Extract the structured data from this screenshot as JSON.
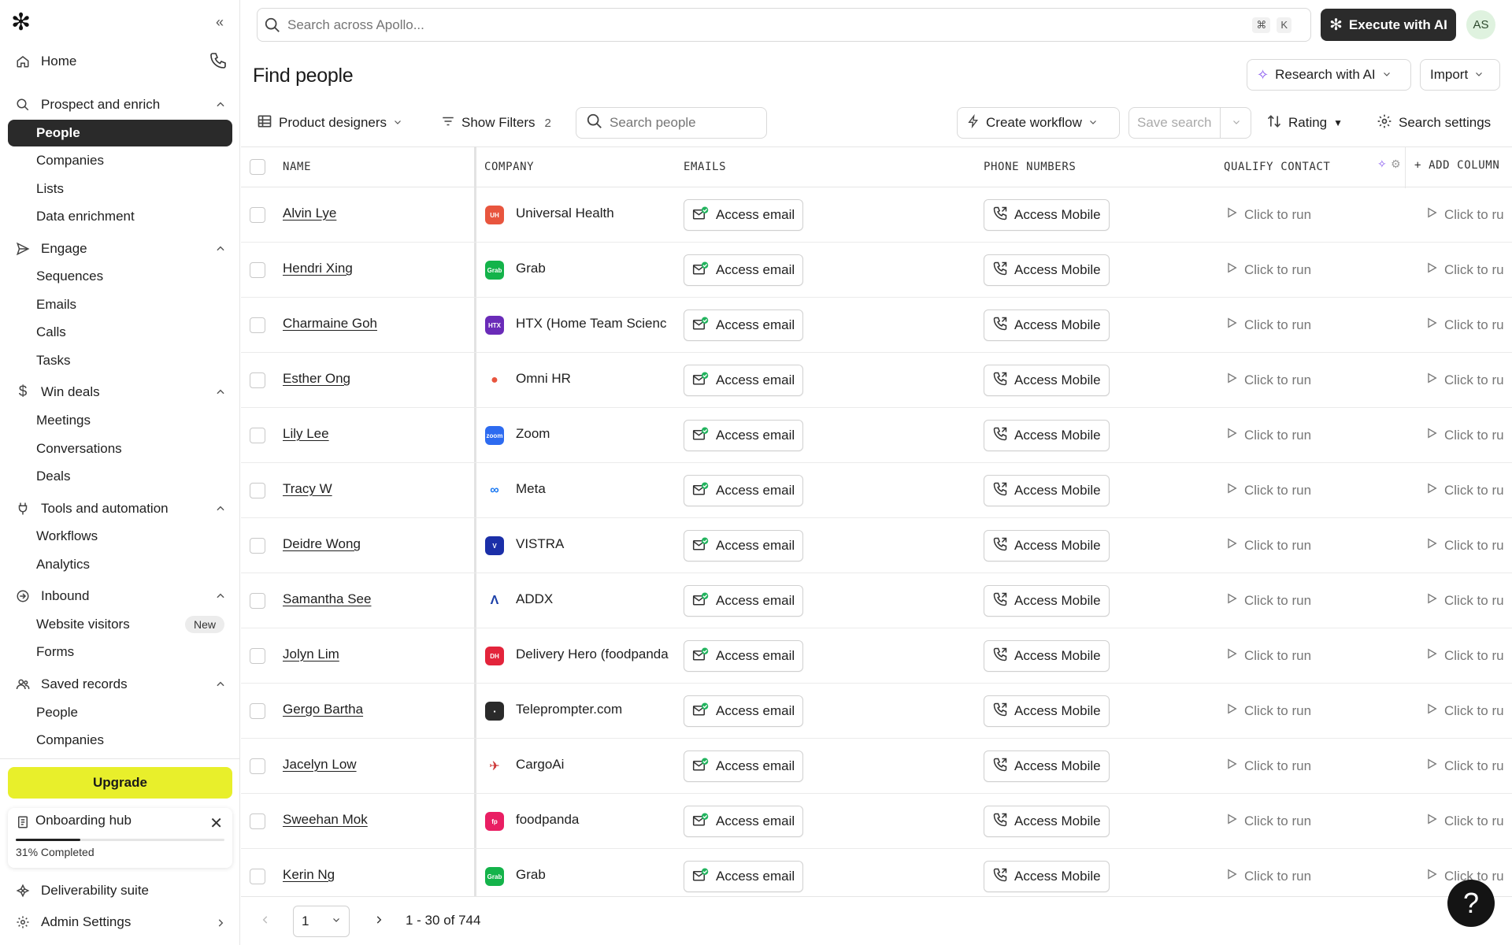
{
  "search": {
    "placeholder": "Search across Apollo...",
    "kbd1": "⌘",
    "kbd2": "K"
  },
  "top": {
    "execute_label": "Execute with AI",
    "avatar_initials": "AS"
  },
  "sidebar": {
    "home": "Home",
    "prospect": "Prospect and enrich",
    "people": "People",
    "companies": "Companies",
    "lists": "Lists",
    "data_enrichment": "Data enrichment",
    "engage": "Engage",
    "sequences": "Sequences",
    "emails": "Emails",
    "calls": "Calls",
    "tasks": "Tasks",
    "win_deals": "Win deals",
    "meetings": "Meetings",
    "conversations": "Conversations",
    "deals": "Deals",
    "tools": "Tools and automation",
    "workflows": "Workflows",
    "analytics": "Analytics",
    "inbound": "Inbound",
    "website_visitors": "Website visitors",
    "new_badge": "New",
    "forms": "Forms",
    "saved_records": "Saved records",
    "saved_people": "People",
    "saved_companies": "Companies",
    "upgrade": "Upgrade",
    "onboarding_title": "Onboarding hub",
    "onboarding_pct_text": "31% Completed",
    "onboarding_progress": 0.31,
    "deliverability": "Deliverability suite",
    "admin": "Admin Settings"
  },
  "header": {
    "title": "Find people",
    "research_ai": "Research with AI",
    "import": "Import",
    "list_view": "Product designers",
    "show_filters": "Show Filters",
    "filter_count": "2",
    "search_people_placeholder": "Search people",
    "create_workflow": "Create workflow",
    "save_search": "Save search",
    "rating": "Rating",
    "search_settings": "Search settings"
  },
  "table": {
    "columns": {
      "name": "NAME",
      "company": "COMPANY",
      "emails": "EMAILS",
      "phone": "PHONE NUMBERS",
      "qualify": "QUALIFY CONTACT",
      "add_column": "ADD COLUMN"
    },
    "access_email": "Access email",
    "access_mobile": "Access Mobile",
    "click_to_run": "Click to run",
    "click_to_run_clipped": "Click to ru",
    "rows": [
      {
        "name": "Alvin Lye",
        "company": "Universal Health",
        "logo_text": "UH",
        "logo_color": "#e8553e"
      },
      {
        "name": "Hendri Xing",
        "company": "Grab",
        "logo_text": "Grab",
        "logo_color": "#14b34a"
      },
      {
        "name": "Charmaine Goh",
        "company": "HTX (Home Team Scienc",
        "logo_text": "HTX",
        "logo_color": "#6a2bb8"
      },
      {
        "name": "Esther Ong",
        "company": "Omni HR",
        "logo_text": "●",
        "logo_color": "#ffffff"
      },
      {
        "name": "Lily Lee",
        "company": "Zoom",
        "logo_text": "zoom",
        "logo_color": "#2d6bf0"
      },
      {
        "name": "Tracy W",
        "company": "Meta",
        "logo_text": "∞",
        "logo_color": "#ffffff"
      },
      {
        "name": "Deidre Wong",
        "company": "VISTRA",
        "logo_text": "V",
        "logo_color": "#1b2fa8"
      },
      {
        "name": "Samantha See",
        "company": "ADDX",
        "logo_text": "Λ",
        "logo_color": "#ffffff"
      },
      {
        "name": "Jolyn Lim",
        "company": "Delivery Hero (foodpanda",
        "logo_text": "DH",
        "logo_color": "#e3243b"
      },
      {
        "name": "Gergo Bartha",
        "company": "Teleprompter.com",
        "logo_text": "▪",
        "logo_color": "#2a2a2a"
      },
      {
        "name": "Jacelyn Low",
        "company": "CargoAi",
        "logo_text": "✈",
        "logo_color": "#ffffff"
      },
      {
        "name": "Sweehan Mok",
        "company": "foodpanda",
        "logo_text": "fp",
        "logo_color": "#e91e63"
      },
      {
        "name": "Kerin Ng",
        "company": "Grab",
        "logo_text": "Grab",
        "logo_color": "#14b34a"
      }
    ]
  },
  "footer": {
    "page": "1",
    "range": "1 - 30 of 744"
  },
  "help": {
    "label": "?"
  }
}
